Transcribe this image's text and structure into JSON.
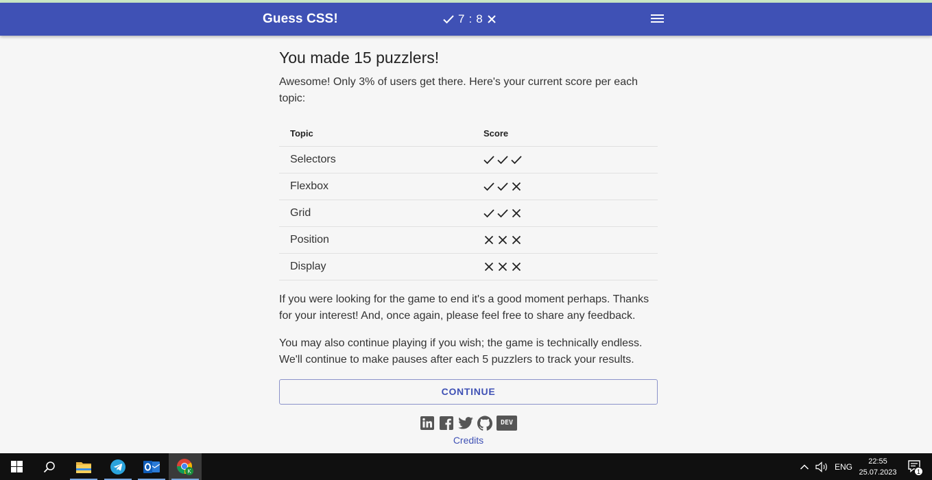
{
  "header": {
    "title": "Guess CSS!",
    "score_right": "7",
    "score_sep": ":",
    "score_wrong": "8"
  },
  "main": {
    "heading": "You made 15 puzzlers!",
    "intro": "Awesome! Only 3% of users get there. Here's your current score per each topic:",
    "table": {
      "columns": [
        "Topic",
        "Score"
      ],
      "rows": [
        {
          "topic": "Selectors",
          "marks": [
            "check",
            "check",
            "check"
          ]
        },
        {
          "topic": "Flexbox",
          "marks": [
            "check",
            "check",
            "cross"
          ]
        },
        {
          "topic": "Grid",
          "marks": [
            "check",
            "check",
            "cross"
          ]
        },
        {
          "topic": "Position",
          "marks": [
            "cross",
            "cross",
            "cross"
          ]
        },
        {
          "topic": "Display",
          "marks": [
            "cross",
            "cross",
            "cross"
          ]
        }
      ]
    },
    "paragraph1": "If you were looking for the game to end it's a good moment perhaps. Thanks for your interest! And, once again, please feel free to share any feedback.",
    "paragraph2": "You may also continue playing if you wish; the game is technically endless. We'll continue to make pauses after each 5 puzzlers to track your results.",
    "continue_label": "CONTINUE",
    "socials": [
      "linkedin-icon",
      "facebook-icon",
      "twitter-icon",
      "github-icon",
      "dev-icon"
    ],
    "dev_badge": "DEV",
    "credits_label": "Credits"
  },
  "taskbar": {
    "apps": [
      "windows-start-icon",
      "search-icon",
      "file-explorer-icon",
      "telegram-icon",
      "outlook-icon",
      "chrome-icon"
    ],
    "language": "ENG",
    "time": "22:55",
    "date": "25.07.2023",
    "notification_count": "1"
  },
  "colors": {
    "appbar": "#3f51b5",
    "accent": "#3f51b5",
    "background": "#f6f6f6"
  }
}
